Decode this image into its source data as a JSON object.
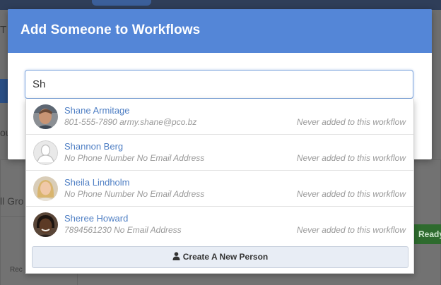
{
  "modal": {
    "title": "Add Someone to Workflows"
  },
  "search": {
    "value": "Sh"
  },
  "results": [
    {
      "name": "Shane Armitage",
      "contact": "801-555-7890 army.shane@pco.bz",
      "status": "Never added to this workflow",
      "avatar": "photo"
    },
    {
      "name": "Shannon Berg",
      "contact": "No Phone Number No Email Address",
      "status": "Never added to this workflow",
      "avatar": "placeholder"
    },
    {
      "name": "Sheila Lindholm",
      "contact": "No Phone Number No Email Address",
      "status": "Never added to this workflow",
      "avatar": "photo"
    },
    {
      "name": "Sheree Howard",
      "contact": "7894561230 No Email Address",
      "status": "Never added to this workflow",
      "avatar": "photo"
    }
  ],
  "create_button": {
    "label": "Create A New Person",
    "icon": "person-icon"
  },
  "background": {
    "fragment_left": "ll Gro",
    "fragment_ready": "Ready",
    "fragment_bottom": "Rec",
    "fragment_top": "T",
    "fragment_mid": "ou"
  },
  "colors": {
    "header": "#5486d7",
    "link": "#4f7fc4",
    "muted": "#999999"
  }
}
